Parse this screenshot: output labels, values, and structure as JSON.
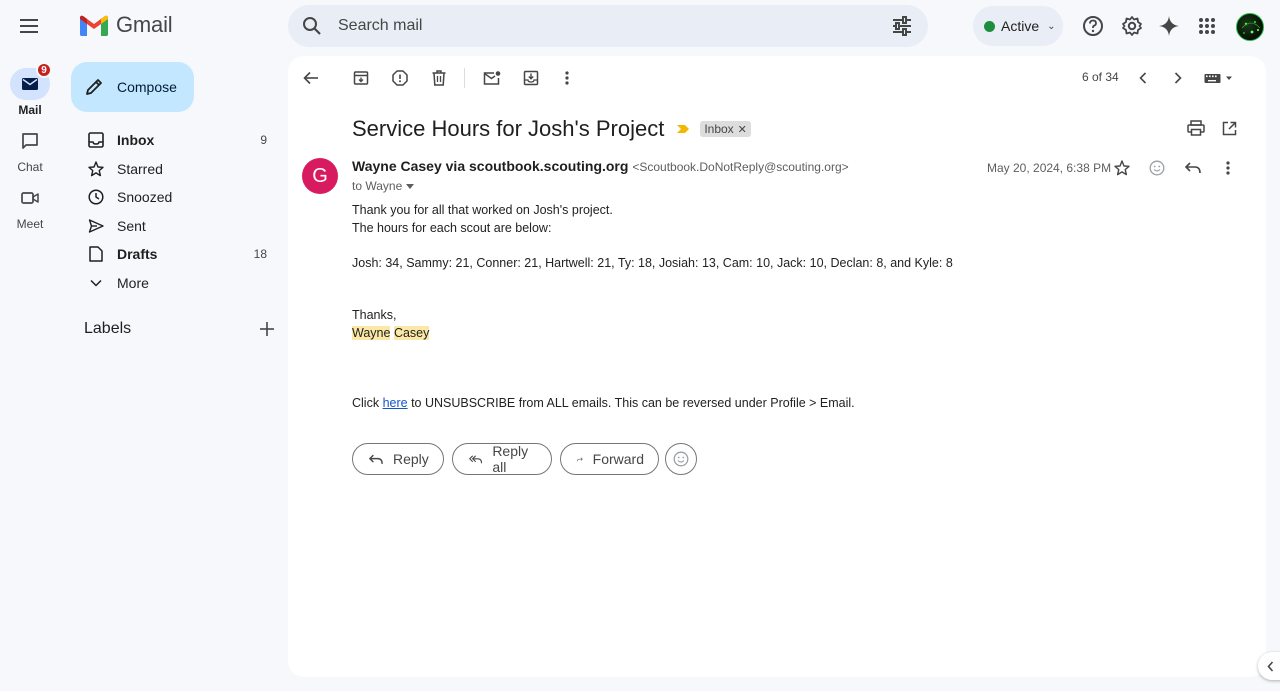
{
  "app": {
    "name": "Gmail",
    "search_placeholder": "Search mail",
    "status_label": "Active"
  },
  "rail": {
    "mail_label": "Mail",
    "mail_badge": "9",
    "chat_label": "Chat",
    "meet_label": "Meet"
  },
  "sidebar": {
    "compose_label": "Compose",
    "items": [
      {
        "label": "Inbox",
        "count": "9",
        "icon": "inbox-icon"
      },
      {
        "label": "Starred",
        "count": "",
        "icon": "star-icon"
      },
      {
        "label": "Snoozed",
        "count": "",
        "icon": "clock-icon"
      },
      {
        "label": "Sent",
        "count": "",
        "icon": "send-icon"
      },
      {
        "label": "Drafts",
        "count": "18",
        "icon": "draft-icon"
      },
      {
        "label": "More",
        "count": "",
        "icon": "chevron-down-icon"
      }
    ],
    "labels_title": "Labels"
  },
  "toolbar": {
    "pager": "6 of 34"
  },
  "message": {
    "subject": "Service Hours for Josh's Project",
    "label_chip": "Inbox",
    "avatar_letter": "G",
    "sender_name": "Wayne Casey via scoutbook.scouting.org",
    "sender_email": "<Scoutbook.DoNotReply@scouting.org>",
    "to": "to Wayne",
    "date": "May 20, 2024, 6:38 PM",
    "body_line1": "Thank you for all that worked on Josh's project.",
    "body_line2": "The hours for each scout are below:",
    "body_line3": "Josh: 34, Sammy: 21, Conner: 21, Hartwell: 21, Ty: 18, Josiah: 13, Cam: 10, Jack: 10, Declan: 8, and Kyle: 8",
    "thanks": "Thanks,",
    "sig_first": "Wayne",
    "sig_last": "Casey",
    "unsub_prefix": "Click ",
    "unsub_link": "here",
    "unsub_suffix": " to UNSUBSCRIBE from ALL emails. This can be reversed under Profile > Email."
  },
  "actions": {
    "reply": "Reply",
    "reply_all": "Reply all",
    "forward": "Forward"
  }
}
